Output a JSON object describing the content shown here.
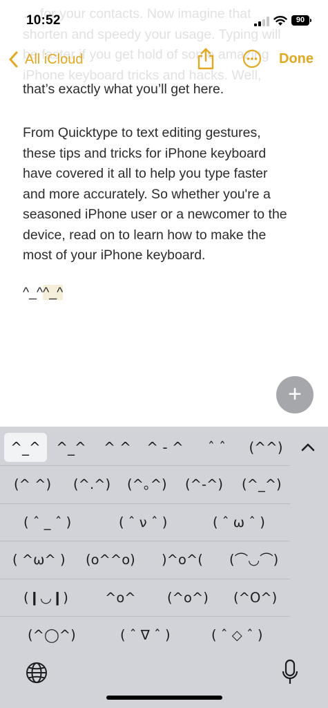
{
  "status": {
    "time": "10:52",
    "battery": "90"
  },
  "nav": {
    "back_label": "All iCloud",
    "done_label": "Done"
  },
  "note": {
    "faded_lines": [
      "… for your contacts. Now imagine that",
      "shorten and speedy your usage. Typing will",
      "be faster if you get hold of some amazing",
      "iPhone keyboard tricks and hacks. Well,"
    ],
    "line_partial": "that’s exactly what you’ll get here.",
    "paragraph_lines": [
      "From Quicktype to text editing gestures,",
      "these tips and tricks for iPhone keyboard",
      "have covered it all to help you type faster",
      "and more accurately. So whether you're a",
      "seasoned iPhone user or a newcomer to the",
      "device, read on to learn how to make the",
      "most of your iPhone keyboard."
    ],
    "emote_plain": "^_^",
    "emote_highlighted": "^_^"
  },
  "keyboard": {
    "suggestions": [
      "^_^",
      "^_^",
      "^ ^",
      "^ - ^",
      "ˆ ˆ",
      "(^^)"
    ],
    "rows": [
      [
        "(^ ^)",
        "(^.^)",
        "(^｡^)",
        "(^-^)",
        "(^_^)"
      ],
      [
        "( ˆ _ ˆ )",
        "( ˆ ν ˆ )",
        "( ˆ ω ˆ )"
      ],
      [
        "( ^ω^ )",
        "(o^^o)",
        ")^o^(",
        "(⌒◡⌒)"
      ],
      [
        "(❙◡❙)",
        "^o^",
        "(^o^)",
        "(^O^)"
      ],
      [
        "(^◯^)",
        "( ˆ ∇ ˆ )",
        "( ˆ ◇ ˆ )"
      ]
    ]
  },
  "colors": {
    "accent": "#e2a820",
    "keyboard_bg": "#d1d3d9",
    "fab_bg": "#a6a7ab"
  }
}
